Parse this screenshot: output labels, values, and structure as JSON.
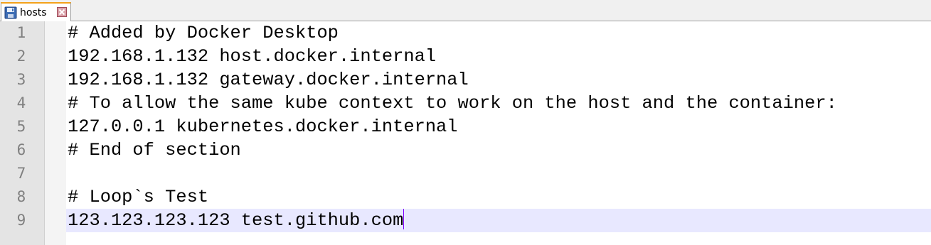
{
  "tab": {
    "label": "hosts",
    "icon": "save-icon",
    "close_icon": "close-icon",
    "accent": "#f3a21b"
  },
  "editor": {
    "current_line": 9,
    "caret_color": "#8000ff",
    "current_line_bg": "#e8e8ff",
    "lines": [
      {
        "number": "1",
        "text": "# Added by Docker Desktop"
      },
      {
        "number": "2",
        "text": "192.168.1.132 host.docker.internal"
      },
      {
        "number": "3",
        "text": "192.168.1.132 gateway.docker.internal"
      },
      {
        "number": "4",
        "text": "# To allow the same kube context to work on the host and the container:"
      },
      {
        "number": "5",
        "text": "127.0.0.1 kubernetes.docker.internal"
      },
      {
        "number": "6",
        "text": "# End of section"
      },
      {
        "number": "7",
        "text": ""
      },
      {
        "number": "8",
        "text": "# Loop`s Test"
      },
      {
        "number": "9",
        "text": "123.123.123.123 test.github.com"
      }
    ]
  }
}
